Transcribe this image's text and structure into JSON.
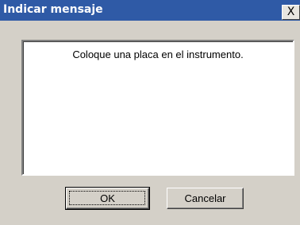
{
  "window": {
    "title": "Indicar mensaje",
    "close_label": "X"
  },
  "message": {
    "text": "Coloque una placa en el instrumento."
  },
  "buttons": {
    "ok_label": "OK",
    "cancel_label": "Cancelar"
  },
  "colors": {
    "titlebar": "#2f5aa6",
    "dialog_face": "#d4d0c8",
    "message_bg": "#ffffff"
  }
}
